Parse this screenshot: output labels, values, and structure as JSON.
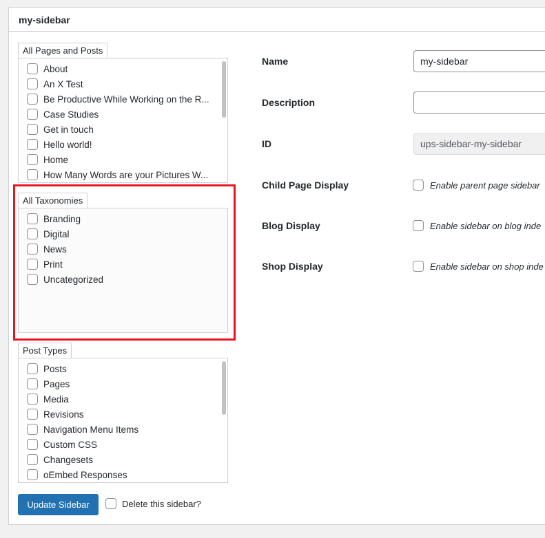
{
  "panel": {
    "title": "my-sidebar"
  },
  "pages_box": {
    "tab_label": "All Pages and Posts",
    "items": [
      "About",
      "An X Test",
      "Be Productive While Working on the R...",
      "Case Studies",
      "Get in touch",
      "Hello world!",
      "Home",
      "How Many Words are your Pictures W..."
    ]
  },
  "taxonomies_box": {
    "tab_label": "All Taxonomies",
    "items": [
      "Branding",
      "Digital",
      "News",
      "Print",
      "Uncategorized"
    ]
  },
  "post_types_box": {
    "tab_label": "Post Types",
    "items": [
      "Posts",
      "Pages",
      "Media",
      "Revisions",
      "Navigation Menu Items",
      "Custom CSS",
      "Changesets",
      "oEmbed Responses"
    ]
  },
  "form": {
    "name_label": "Name",
    "name_value": "my-sidebar",
    "description_label": "Description",
    "description_value": "",
    "id_label": "ID",
    "id_value": "ups-sidebar-my-sidebar",
    "child_page_label": "Child Page Display",
    "child_page_check": "Enable parent page sidebar",
    "blog_label": "Blog Display",
    "blog_check": "Enable sidebar on blog inde",
    "shop_label": "Shop Display",
    "shop_check": "Enable sidebar on shop inde"
  },
  "footer": {
    "update_button": "Update Sidebar",
    "delete_label": "Delete this sidebar?"
  },
  "colors": {
    "primary_button": "#2271b1",
    "highlight_border": "#e8141e",
    "panel_border": "#ccd0d4"
  }
}
